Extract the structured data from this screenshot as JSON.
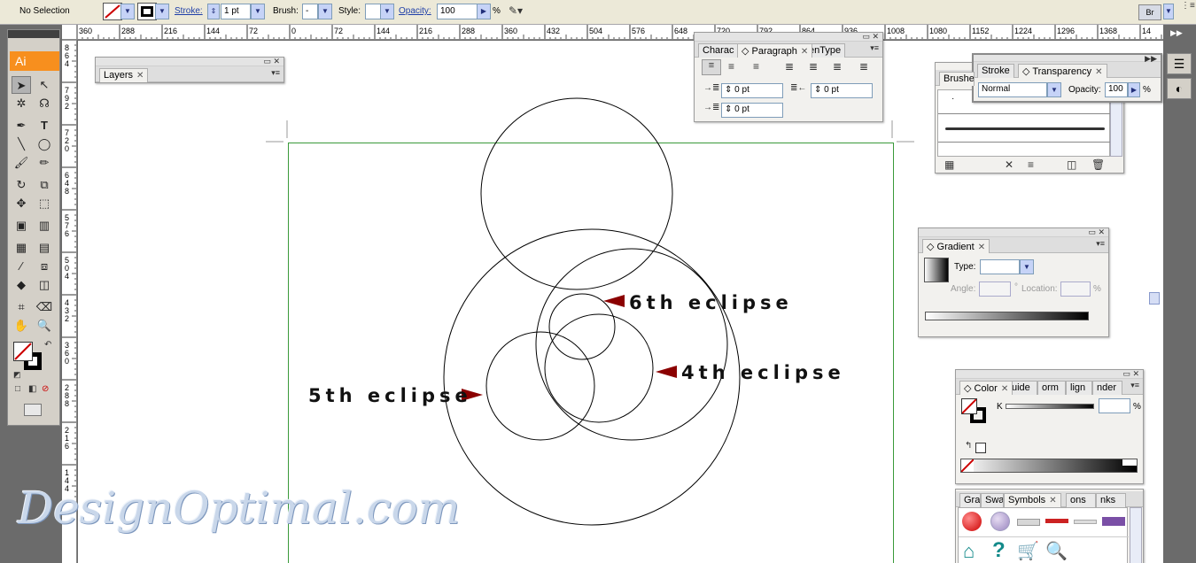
{
  "control_bar": {
    "selection_status": "No Selection",
    "stroke_label": "Stroke:",
    "stroke_weight": "1 pt",
    "brush_label": "Brush:",
    "brush_value": "-",
    "style_label": "Style:",
    "opacity_label": "Opacity:",
    "opacity_value": "100",
    "opacity_unit": "%",
    "bridge_label": "Br"
  },
  "tools": {
    "logo": "Ai",
    "type_tool": "T"
  },
  "rulers": {
    "horizontal": [
      "360",
      "288",
      "216",
      "144",
      "72",
      "0",
      "72",
      "144",
      "216",
      "288",
      "360",
      "432",
      "504",
      "576",
      "648",
      "720",
      "792",
      "864",
      "936",
      "1008",
      "1080",
      "1152",
      "1224",
      "1296",
      "1368",
      "14"
    ],
    "vertical": [
      [
        "8",
        "6",
        "4"
      ],
      [
        "7",
        "9",
        "2"
      ],
      [
        "7",
        "2",
        "0"
      ],
      [
        "6",
        "4",
        "8"
      ],
      [
        "5",
        "7",
        "6"
      ],
      [
        "5",
        "0",
        "4"
      ],
      [
        "4",
        "3",
        "2"
      ],
      [
        "3",
        "6",
        "0"
      ],
      [
        "2",
        "8",
        "8"
      ],
      [
        "2",
        "1",
        "6"
      ],
      [
        "1",
        "4",
        "4"
      ]
    ]
  },
  "layers_panel": {
    "tab": "Layers"
  },
  "paragraph_panel": {
    "tabs": [
      "Charac",
      "Paragraph",
      "enType"
    ],
    "indent_left": "0 pt",
    "indent_right": "0 pt",
    "first_line": "0 pt"
  },
  "brushes_panel": {
    "tab": "Brushe"
  },
  "transparency_panel": {
    "tabs": [
      "Stroke",
      "Transparency"
    ],
    "blend_mode": "Normal",
    "opacity_label": "Opacity:",
    "opacity_value": "100",
    "opacity_unit": "%"
  },
  "gradient_panel": {
    "tab": "Gradient",
    "type_label": "Type:",
    "angle_label": "Angle:",
    "location_label": "Location:",
    "degree_sign": "°",
    "percent_sign": "%"
  },
  "color_panel": {
    "tabs": [
      "Color",
      "uide",
      "orm",
      "lign",
      "nder"
    ],
    "k_label": "K",
    "percent_sign": "%"
  },
  "symbols_panel": {
    "tabs": [
      "Gra",
      "Swa",
      "Symbols",
      "ons",
      "nks"
    ]
  },
  "artboard": {
    "label_6th": "6th eclipse",
    "label_4th": "4th eclipse",
    "label_5th": "5th eclipse"
  },
  "watermark": "DesignOptimal.com",
  "colors": {
    "arrow": "#8b0000",
    "artboard_border": "#3a9a3a",
    "tool_logo": "#f78f1e"
  }
}
